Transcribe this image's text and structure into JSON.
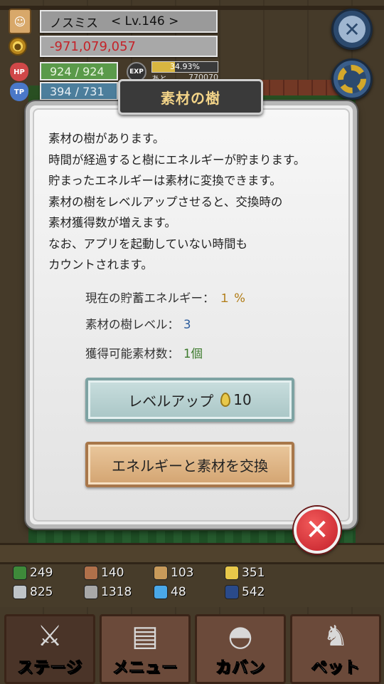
{
  "hud": {
    "player_name": "ノスミス",
    "level": "< Lv.146 >",
    "gold": "-971,079,057",
    "hp": "924 / 924",
    "tp": "394 / 731",
    "exp_percent": "34.93%",
    "exp_fraction": 0.3493,
    "exp_rest_label": "あと",
    "exp_rest_value": "770070",
    "icons": {
      "coin": "coin-icon",
      "hp": "HP",
      "tp": "TP",
      "exp": "EXP"
    }
  },
  "dialog": {
    "title": "素材の樹",
    "description": [
      "素材の樹があります。",
      "時間が経過すると樹にエネルギーが貯まります。",
      "貯まったエネルギーは素材に変換できます。",
      "素材の樹をレベルアップさせると、交換時の",
      "素材獲得数が増えます。",
      "なお、アプリを起動していない時間も",
      "カウントされます。"
    ],
    "stats": {
      "energy_label": "現在の貯蓄エネルギー：",
      "energy_value": "１ %",
      "tree_level_label": "素材の樹レベル：",
      "tree_level_value": "3",
      "obtainable_label": "獲得可能素材数：",
      "obtainable_value": "1個"
    },
    "levelup_button": {
      "label": "レベルアップ",
      "cost": "10"
    },
    "exchange_button_label": "エネルギーと素材を交換"
  },
  "resources": [
    {
      "icon": "herb-icon",
      "value": "249",
      "color": "#3e8a3a"
    },
    {
      "icon": "wood-icon",
      "value": "140",
      "color": "#b0704a"
    },
    {
      "icon": "plank-icon",
      "value": "103",
      "color": "#c89a5a"
    },
    {
      "icon": "drop-icon",
      "value": "351",
      "color": "#e8c84a"
    },
    {
      "icon": "ingot-icon",
      "value": "825",
      "color": "#bfc4c8"
    },
    {
      "icon": "stone-icon",
      "value": "1318",
      "color": "#a8a8a8"
    },
    {
      "icon": "flame-icon",
      "value": "48",
      "color": "#4aa8e8"
    },
    {
      "icon": "orb-icon",
      "value": "542",
      "color": "#2a4a8a"
    }
  ],
  "nav": [
    {
      "label": "ステージ",
      "icon": "crossed-swords-icon"
    },
    {
      "label": "メニュー",
      "icon": "book-icon"
    },
    {
      "label": "カバン",
      "icon": "backpack-icon"
    },
    {
      "label": "ペット",
      "icon": "dragon-icon"
    }
  ],
  "colors": {
    "gold_text": "#c4242a",
    "title_text": "#f3d488",
    "energy_value": "#b07a12",
    "level_value": "#2c5c9c",
    "obtainable_value": "#3c7a2c"
  }
}
